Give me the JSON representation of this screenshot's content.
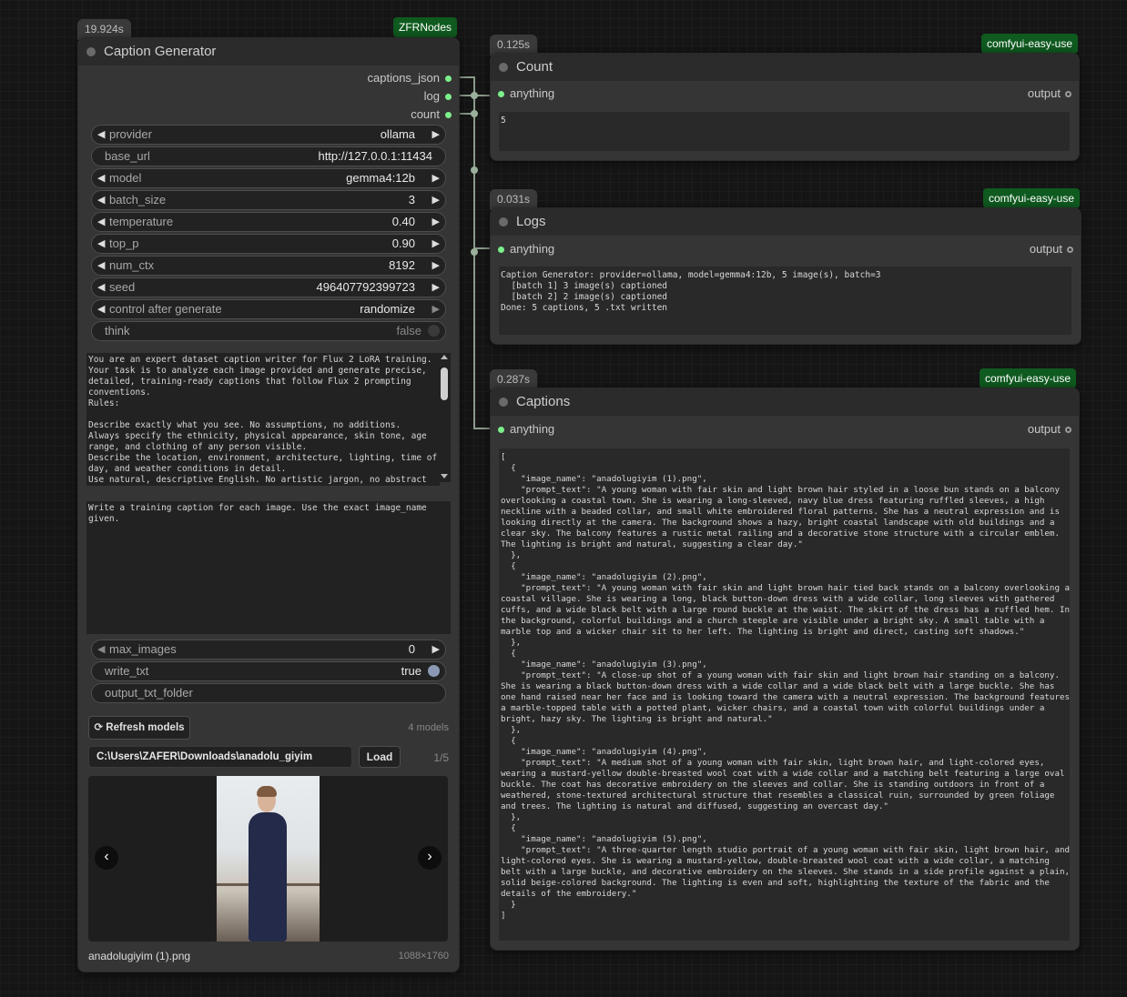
{
  "caption_node": {
    "time": "19.924s",
    "source": "ZFRNodes",
    "title": "Caption Generator",
    "outputs": [
      "captions_json",
      "log",
      "count"
    ],
    "widgets": {
      "provider": {
        "label": "provider",
        "value": "ollama"
      },
      "base_url": {
        "label": "base_url",
        "value": "http://127.0.0.1:11434"
      },
      "model": {
        "label": "model",
        "value": "gemma4:12b"
      },
      "batch_size": {
        "label": "batch_size",
        "value": "3"
      },
      "temperature": {
        "label": "temperature",
        "value": "0.40"
      },
      "top_p": {
        "label": "top_p",
        "value": "0.90"
      },
      "num_ctx": {
        "label": "num_ctx",
        "value": "8192"
      },
      "seed": {
        "label": "seed",
        "value": "496407792399723"
      },
      "control": {
        "label": "control after generate",
        "value": "randomize"
      },
      "think": {
        "label": "think",
        "value": "false"
      },
      "max_images": {
        "label": "max_images",
        "value": "0"
      },
      "write_txt": {
        "label": "write_txt",
        "value": "true"
      },
      "output_txt_folder": {
        "label": "output_txt_folder",
        "value": ""
      }
    },
    "system_prompt": "You are an expert dataset caption writer for Flux 2 LoRA training.\nYour task is to analyze each image provided and generate precise,\ndetailed, training-ready captions that follow Flux 2 prompting\nconventions.\nRules:\n\nDescribe exactly what you see. No assumptions, no additions.\nAlways specify the ethnicity, physical appearance, skin tone, age\nrange, and clothing of any person visible.\nDescribe the location, environment, architecture, lighting, time of\nday, and weather conditions in detail.\nUse natural, descriptive English. No artistic jargon, no abstract",
    "user_prompt": "Write a training caption for each image. Use the exact image_name\ngiven.",
    "refresh_label": "⟳ Refresh models",
    "models_count": "4 models",
    "folder_path": "C:\\Users\\ZAFER\\Downloads\\anadolu_giyim",
    "load_label": "Load",
    "page_indicator": "1/5",
    "prev_icon": "‹",
    "next_icon": "›",
    "image_name": "anadolugiyim (1).png",
    "image_size": "1088×1760"
  },
  "count_node": {
    "time": "0.125s",
    "source": "comfyui-easy-use",
    "title": "Count",
    "input": "anything",
    "output": "output",
    "text": "5"
  },
  "logs_node": {
    "time": "0.031s",
    "source": "comfyui-easy-use",
    "title": "Logs",
    "input": "anything",
    "output": "output",
    "text": "Caption Generator: provider=ollama, model=gemma4:12b, 5 image(s), batch=3\n  [batch 1] 3 image(s) captioned\n  [batch 2] 2 image(s) captioned\nDone: 5 captions, 5 .txt written"
  },
  "captions_node": {
    "time": "0.287s",
    "source": "comfyui-easy-use",
    "title": "Captions",
    "input": "anything",
    "output": "output",
    "text": "[\n  {\n    \"image_name\": \"anadolugiyim (1).png\",\n    \"prompt_text\": \"A young woman with fair skin and light brown hair styled in a loose bun stands on a balcony\noverlooking a coastal town. She is wearing a long-sleeved, navy blue dress featuring ruffled sleeves, a high\nneckline with a beaded collar, and small white embroidered floral patterns. She has a neutral expression and is\nlooking directly at the camera. The background shows a hazy, bright coastal landscape with old buildings and a\nclear sky. The balcony features a rustic metal railing and a decorative stone structure with a circular emblem.\nThe lighting is bright and natural, suggesting a clear day.\"\n  },\n  {\n    \"image_name\": \"anadolugiyim (2).png\",\n    \"prompt_text\": \"A young woman with fair skin and light brown hair tied back stands on a balcony overlooking a\ncoastal village. She is wearing a long, black button-down dress with a wide collar, long sleeves with gathered\ncuffs, and a wide black belt with a large round buckle at the waist. The skirt of the dress has a ruffled hem. In\nthe background, colorful buildings and a church steeple are visible under a bright sky. A small table with a\nmarble top and a wicker chair sit to her left. The lighting is bright and direct, casting soft shadows.\"\n  },\n  {\n    \"image_name\": \"anadolugiyim (3).png\",\n    \"prompt_text\": \"A close-up shot of a young woman with fair skin and light brown hair standing on a balcony.\nShe is wearing a black button-down dress with a wide collar and a wide black belt with a large buckle. She has\none hand raised near her face and is looking toward the camera with a neutral expression. The background features\na marble-topped table with a potted plant, wicker chairs, and a coastal town with colorful buildings under a\nbright, hazy sky. The lighting is bright and natural.\"\n  },\n  {\n    \"image_name\": \"anadolugiyim (4).png\",\n    \"prompt_text\": \"A medium shot of a young woman with fair skin, light brown hair, and light-colored eyes,\nwearing a mustard-yellow double-breasted wool coat with a wide collar and a matching belt featuring a large oval\nbuckle. The coat has decorative embroidery on the sleeves and collar. She is standing outdoors in front of a\nweathered, stone-textured architectural structure that resembles a classical ruin, surrounded by green foliage\nand trees. The lighting is natural and diffused, suggesting an overcast day.\"\n  },\n  {\n    \"image_name\": \"anadolugiyim (5).png\",\n    \"prompt_text\": \"A three-quarter length studio portrait of a young woman with fair skin, light brown hair, and\nlight-colored eyes. She is wearing a mustard-yellow, double-breasted wool coat with a wide collar, a matching\nbelt with a large buckle, and decorative embroidery on the sleeves. She stands in a side profile against a plain,\nsolid beige-colored background. The lighting is even and soft, highlighting the texture of the fabric and the\ndetails of the embroidery.\"\n  }\n]"
  },
  "colors": {
    "source_badge": "#0f5a1f",
    "socket": "#7cf08a",
    "node_bg": "#353535",
    "canvas_bg": "#151515"
  }
}
